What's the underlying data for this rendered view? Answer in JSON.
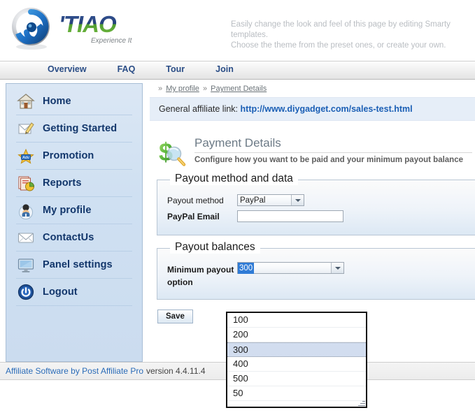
{
  "header": {
    "logo_name": "TIAO",
    "logo_tagline": "Experience It",
    "logo_mark_icon": "spiral-swirl-logo-icon",
    "description_line1": "Easily change the look and feel of this page by editing Smarty templates.",
    "description_line2": "Choose the theme from the preset ones, or create your own."
  },
  "nav": {
    "items": [
      {
        "label": "Overview"
      },
      {
        "label": "FAQ"
      },
      {
        "label": "Tour"
      },
      {
        "label": "Join"
      }
    ]
  },
  "sidebar": {
    "items": [
      {
        "label": "Home",
        "icon": "house-icon"
      },
      {
        "label": "Getting Started",
        "icon": "pencil-note-icon"
      },
      {
        "label": "Promotion",
        "icon": "star-badge-icon"
      },
      {
        "label": "Reports",
        "icon": "pie-chart-documents-icon"
      },
      {
        "label": "My profile",
        "icon": "user-avatar-icon"
      },
      {
        "label": "ContactUs",
        "icon": "envelope-icon"
      },
      {
        "label": "Panel settings",
        "icon": "monitor-icon"
      },
      {
        "label": "Logout",
        "icon": "power-button-icon"
      }
    ]
  },
  "breadcrumb": {
    "separator": "»",
    "items": [
      {
        "label": "My profile"
      },
      {
        "label": "Payment Details"
      }
    ]
  },
  "affiliate_bar": {
    "label": "General affiliate link:",
    "link_text": "http://www.diygadget.com/sales-test.html"
  },
  "page": {
    "icon": "dollar-magnifier-icon",
    "title": "Payment Details",
    "subtitle": "Configure how you want to be paid and your minimum payout balance"
  },
  "payout_method_fieldset": {
    "legend": "Payout method and data",
    "method_label": "Payout method",
    "method_value": "PayPal",
    "method_options": [
      "PayPal"
    ],
    "email_label": "PayPal Email",
    "email_value": "",
    "email_placeholder": ""
  },
  "payout_balances_fieldset": {
    "legend": "Payout balances",
    "minimum_label_line1": "Minimum payout",
    "minimum_label_line2": "option",
    "minimum_value": "300",
    "minimum_options": [
      "100",
      "200",
      "300",
      "400",
      "500",
      "50"
    ],
    "selected_option": "300"
  },
  "actions": {
    "save_label": "Save"
  },
  "footer": {
    "link_text": "Affiliate Software by Post Affiliate Pro",
    "version_text": "version 4.4.11.4"
  },
  "colors": {
    "accent_blue": "#2a4d86",
    "link_blue": "#1b5fb5",
    "sidebar_bg": "#cfe0f2",
    "selection_blue": "#2f7bd6",
    "dropdown_highlight": "#d2ddef"
  }
}
